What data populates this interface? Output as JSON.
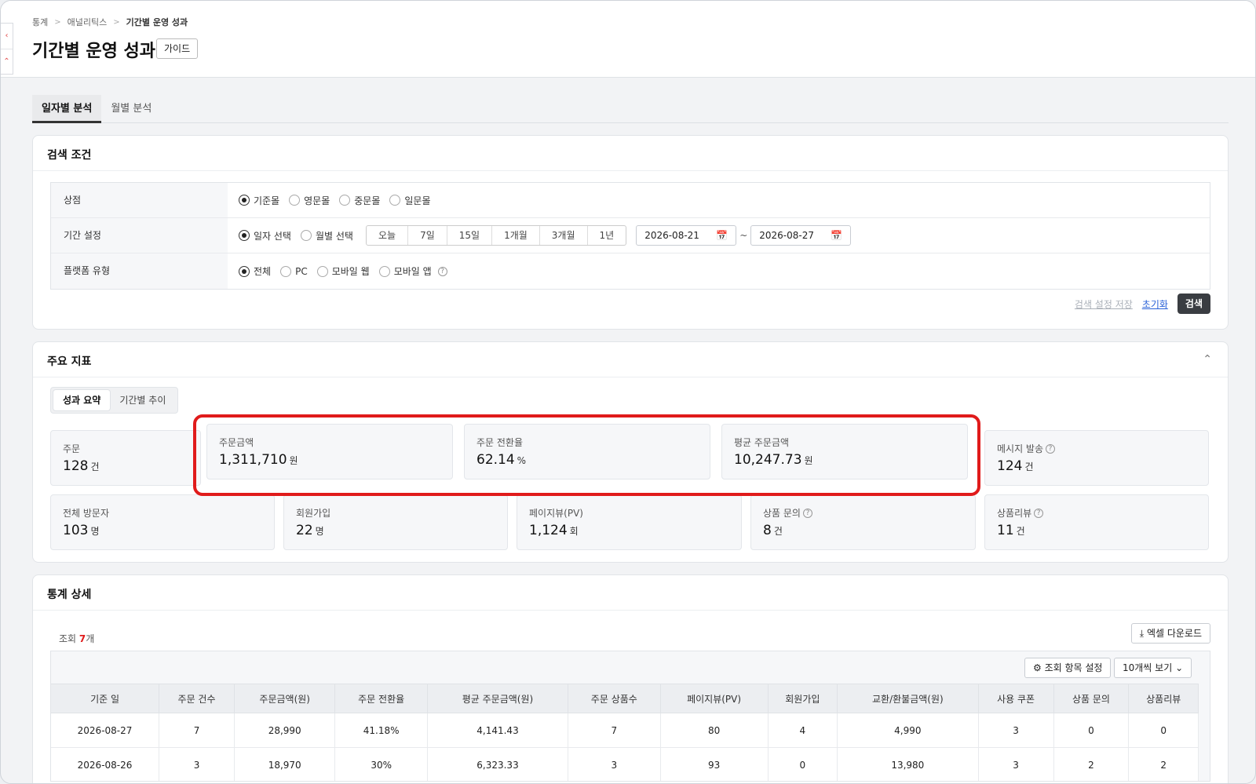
{
  "breadcrumb": [
    "통계",
    "애널리틱스",
    "기간별 운영 성과"
  ],
  "page_title": "기간별 운영 성과",
  "guide_label": "가이드",
  "tabs": [
    "일자별 분석",
    "월별 분석"
  ],
  "search": {
    "title": "검색 조건",
    "store_label": "상점",
    "store_options": [
      "기준몰",
      "영문몰",
      "중문몰",
      "일문몰"
    ],
    "period_label": "기간 설정",
    "period_modes": [
      "일자 선택",
      "월별 선택"
    ],
    "period_presets": [
      "오늘",
      "7일",
      "15일",
      "1개월",
      "3개월",
      "1년"
    ],
    "date_from": "2026-08-21",
    "date_to": "2026-08-27",
    "tilde": "~",
    "platform_label": "플랫폼 유형",
    "platform_options": [
      "전체",
      "PC",
      "모바일 웹",
      "모바일 앱"
    ],
    "save_label": "검색 설정 저장",
    "reset_label": "초기화",
    "search_label": "검색"
  },
  "metrics": {
    "title": "주요 지표",
    "toggle": [
      "성과 요약",
      "기간별 추이"
    ],
    "items": [
      {
        "label": "주문",
        "value": "128",
        "unit": "건"
      },
      {
        "label": "주문금액",
        "value": "1,311,710",
        "unit": "원"
      },
      {
        "label": "주문 전환율",
        "value": "62.14",
        "unit": "%"
      },
      {
        "label": "평균 주문금액",
        "value": "10,247.73",
        "unit": "원"
      },
      {
        "label": "메시지 발송",
        "value": "124",
        "unit": "건"
      },
      {
        "label": "전체 방문자",
        "value": "103",
        "unit": "명"
      },
      {
        "label": "회원가입",
        "value": "22",
        "unit": "명"
      },
      {
        "label": "페이지뷰(PV)",
        "value": "1,124",
        "unit": "회"
      },
      {
        "label": "상품 문의",
        "value": "8",
        "unit": "건"
      },
      {
        "label": "상품리뷰",
        "value": "11",
        "unit": "건"
      }
    ]
  },
  "detail": {
    "title": "통계 상세",
    "count_prefix": "조회",
    "count_value": "7",
    "count_suffix": "개",
    "excel_label": "엑셀 다운로드",
    "columns_label": "조회 항목 설정",
    "page_size_label": "10개씩 보기",
    "headers": [
      "기준 일",
      "주문 건수",
      "주문금액(원)",
      "주문 전환율",
      "평균 주문금액(원)",
      "주문 상품수",
      "페이지뷰(PV)",
      "회원가입",
      "교환/환불금액(원)",
      "사용 쿠폰",
      "상품 문의",
      "상품리뷰"
    ],
    "rows": [
      [
        "2026-08-27",
        "7",
        "28,990",
        "41.18%",
        "4,141.43",
        "7",
        "80",
        "4",
        "4,990",
        "3",
        "0",
        "0"
      ],
      [
        "2026-08-26",
        "3",
        "18,970",
        "30%",
        "6,323.33",
        "3",
        "93",
        "0",
        "13,980",
        "3",
        "2",
        "2"
      ]
    ]
  },
  "colors": {
    "accent_red": "#e01b1b",
    "link_blue": "#2a62d8",
    "dark_button": "#3a3d42"
  }
}
